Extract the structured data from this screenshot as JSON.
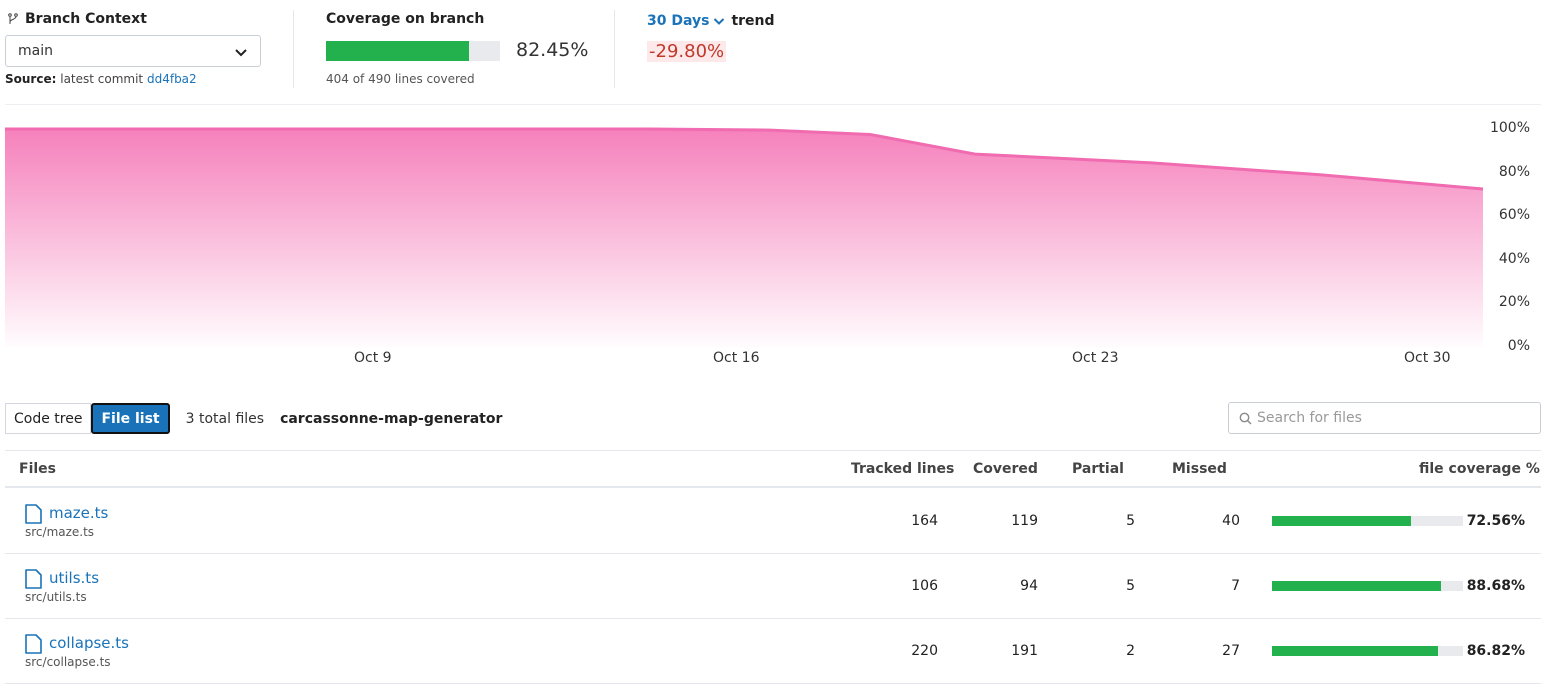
{
  "header": {
    "branch_title": "Branch Context",
    "branch_value": "main",
    "source_label": "Source:",
    "source_text": "latest commit",
    "source_commit": "dd4fba2",
    "coverage_title": "Coverage on branch",
    "coverage_fraction": 0.8245,
    "coverage_pct": "82.45%",
    "coverage_lines": "404 of 490 lines covered",
    "trend_period": "30 Days",
    "trend_label": "trend",
    "trend_value": "-29.80%"
  },
  "chart_data": {
    "type": "area",
    "x_ticks": [
      "Oct 9",
      "Oct 16",
      "Oct 23",
      "Oct 30"
    ],
    "y_ticks": [
      "100%",
      "80%",
      "60%",
      "40%",
      "20%",
      "0%"
    ],
    "ylim": [
      0,
      100
    ],
    "x": [
      "Oct 1",
      "Oct 8",
      "Oct 15",
      "Oct 18",
      "Oct 20",
      "Oct 22",
      "Oct 25",
      "Oct 28",
      "Oct 31"
    ],
    "values": [
      100,
      100,
      100,
      99.5,
      97.5,
      88.5,
      84.5,
      79,
      72.5
    ],
    "color": "#f06bb0"
  },
  "toolbar": {
    "code_tree_label": "Code tree",
    "file_list_label": "File list",
    "total_files": "3 total files",
    "repo_name": "carcassonne-map-generator",
    "search_placeholder": "Search for files"
  },
  "table": {
    "headers": {
      "files": "Files",
      "tracked": "Tracked lines",
      "covered": "Covered",
      "partial": "Partial",
      "missed": "Missed",
      "coverage": "file coverage %"
    },
    "rows": [
      {
        "name": "maze.ts",
        "path": "src/maze.ts",
        "tracked": "164",
        "covered": "119",
        "partial": "5",
        "missed": "40",
        "pct": "72.56%",
        "fraction": 0.7256
      },
      {
        "name": "utils.ts",
        "path": "src/utils.ts",
        "tracked": "106",
        "covered": "94",
        "partial": "5",
        "missed": "7",
        "pct": "88.68%",
        "fraction": 0.8868
      },
      {
        "name": "collapse.ts",
        "path": "src/collapse.ts",
        "tracked": "220",
        "covered": "191",
        "partial": "2",
        "missed": "27",
        "pct": "86.82%",
        "fraction": 0.8682
      }
    ]
  },
  "colors": {
    "accent": "#1a73b8",
    "coverage_green": "#22b14c",
    "trend_negative": "#c0392b",
    "chart_line": "#f06bb0"
  }
}
